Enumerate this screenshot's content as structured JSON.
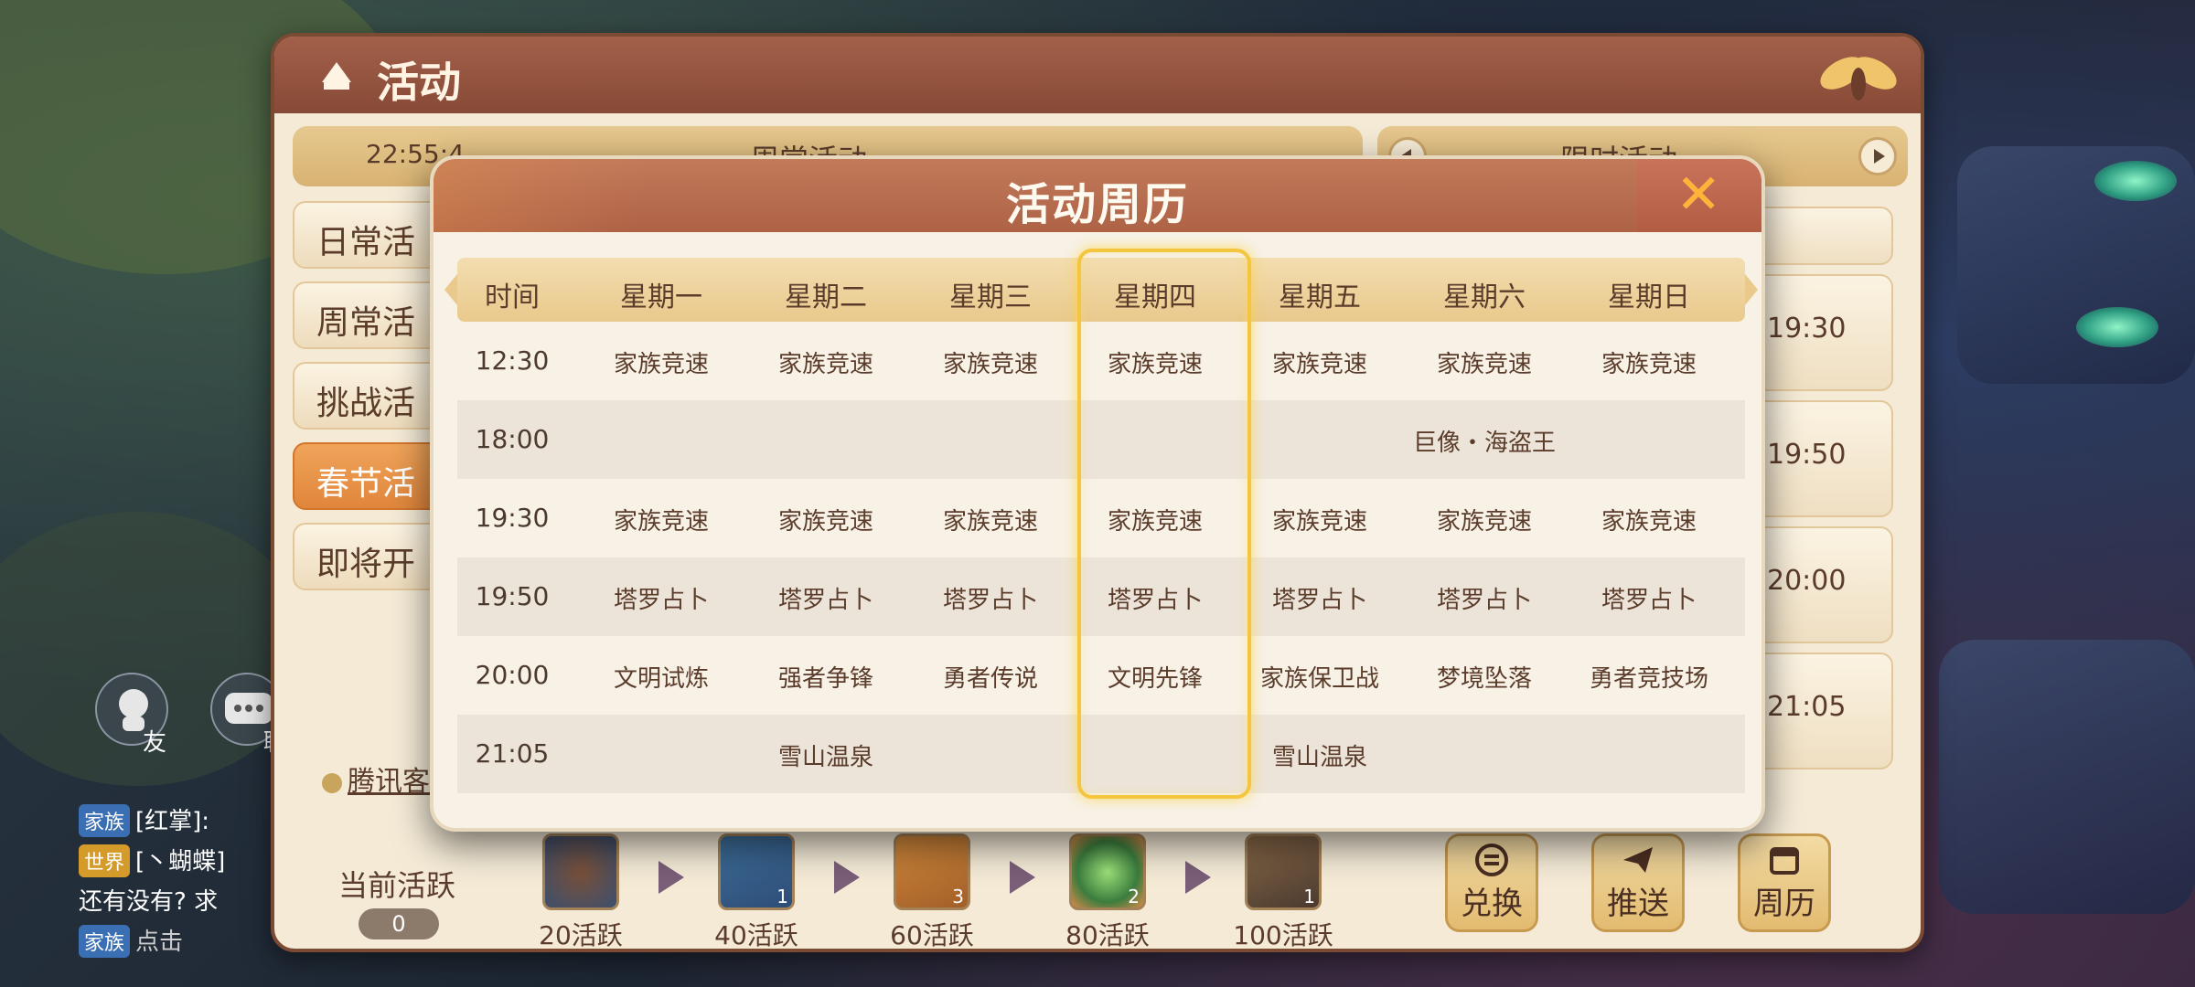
{
  "panel": {
    "title": "活动",
    "clock": "22:55:4",
    "tab_left_label": "周常活动",
    "tab_right_label": "限时活动",
    "side_menu": [
      "日常活",
      "周常活",
      "挑战活",
      "春节活",
      "即将开"
    ],
    "right_times": [
      "",
      "19:30",
      "19:50",
      "20:00",
      "21:05"
    ],
    "friend_label": "友",
    "chat_icon_label": "聊",
    "tencent_label": "腾讯客",
    "chat": [
      {
        "tag": "家族",
        "text": "[红掌]:"
      },
      {
        "tag": "世界",
        "text": "[丶蝴蝶]"
      },
      {
        "tag": "",
        "text": "还有没有? 求"
      },
      {
        "tag": "家族",
        "text": "点击"
      }
    ],
    "current_active_label": "当前活跃",
    "current_active_value": "0",
    "rewards": [
      {
        "label": "20活跃",
        "count": ""
      },
      {
        "label": "40活跃",
        "count": "1"
      },
      {
        "label": "60活跃",
        "count": "3"
      },
      {
        "label": "80活跃",
        "count": "2"
      },
      {
        "label": "100活跃",
        "count": "1"
      }
    ],
    "actions": {
      "exchange": "兑换",
      "push": "推送",
      "calendar": "周历"
    }
  },
  "modal": {
    "title": "活动周历",
    "close_icon": "close-x-icon",
    "header": {
      "time": "时间",
      "days": [
        "星期一",
        "星期二",
        "星期三",
        "星期四",
        "星期五",
        "星期六",
        "星期日"
      ]
    },
    "highlight_day": "星期四",
    "rows": [
      {
        "time": "12:30",
        "cells": [
          "家族竞速",
          "家族竞速",
          "家族竞速",
          "家族竞速",
          "家族竞速",
          "家族竞速",
          "家族竞速"
        ]
      },
      {
        "time": "18:00",
        "cells": [
          "",
          "",
          "",
          "",
          "",
          "巨像・海盗王",
          ""
        ]
      },
      {
        "time": "19:30",
        "cells": [
          "家族竞速",
          "家族竞速",
          "家族竞速",
          "家族竞速",
          "家族竞速",
          "家族竞速",
          "家族竞速"
        ]
      },
      {
        "time": "19:50",
        "cells": [
          "塔罗占卜",
          "塔罗占卜",
          "塔罗占卜",
          "塔罗占卜",
          "塔罗占卜",
          "塔罗占卜",
          "塔罗占卜"
        ]
      },
      {
        "time": "20:00",
        "cells": [
          "文明试炼",
          "强者争锋",
          "勇者传说",
          "文明先锋",
          "家族保卫战",
          "梦境坠落",
          "勇者竞技场"
        ]
      },
      {
        "time": "21:05",
        "cells": [
          "",
          "雪山温泉",
          "",
          "",
          "雪山温泉",
          "",
          ""
        ]
      }
    ]
  }
}
